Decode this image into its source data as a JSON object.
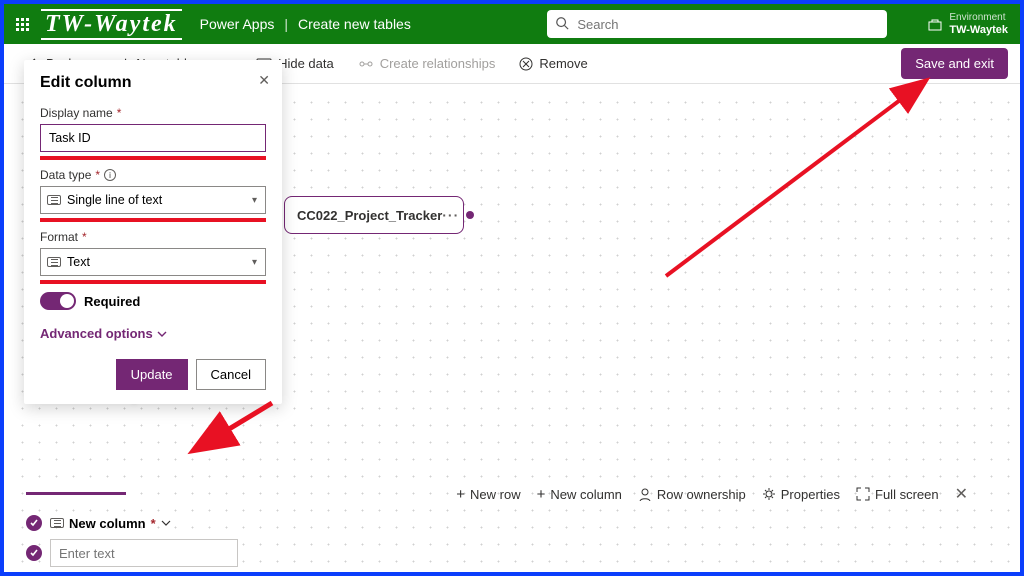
{
  "header": {
    "brand": "TW-Waytek",
    "app": "Power Apps",
    "page": "Create new tables",
    "searchPlaceholder": "Search",
    "envLabel": "Environment",
    "envName": "TW-Waytek"
  },
  "toolbar": {
    "back": "Back",
    "newTable": "New table",
    "hideData": "Hide data",
    "createRel": "Create relationships",
    "remove": "Remove",
    "saveExit": "Save and exit"
  },
  "node": {
    "name": "CC022_Project_Tracker"
  },
  "panel": {
    "title": "Edit column",
    "displayNameLbl": "Display name",
    "displayNameVal": "Task ID",
    "dataTypeLbl": "Data type",
    "dataTypeVal": "Single line of text",
    "formatLbl": "Format",
    "formatVal": "Text",
    "requiredLbl": "Required",
    "advanced": "Advanced options",
    "update": "Update",
    "cancel": "Cancel"
  },
  "tableTools": {
    "newRow": "New row",
    "newCol": "New column",
    "rowOwn": "Row ownership",
    "props": "Properties",
    "full": "Full screen"
  },
  "grid": {
    "columnName": "New column",
    "placeholder": "Enter text"
  }
}
